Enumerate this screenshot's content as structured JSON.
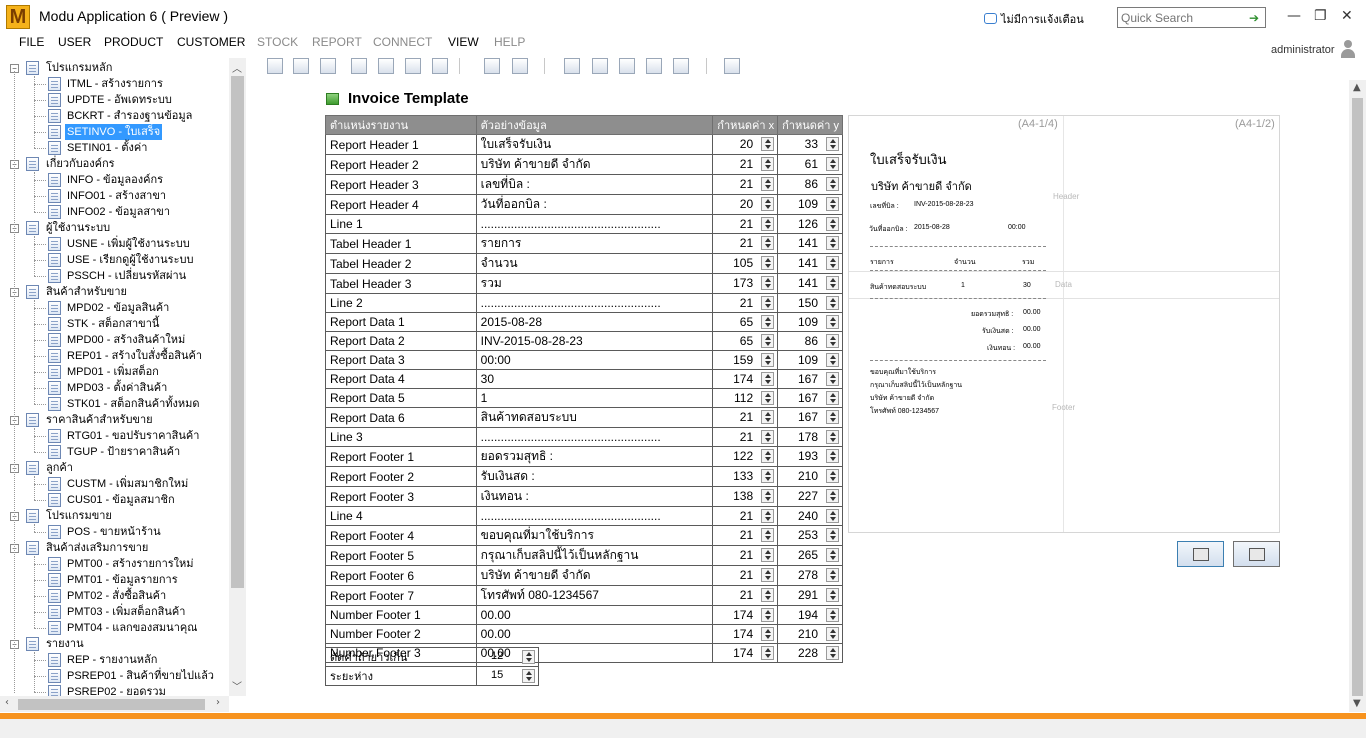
{
  "app": {
    "title": "Modu Application 6 ( Preview )",
    "logo_letter": "M"
  },
  "header": {
    "notifications": "ไม่มีการแจ้งเตือน",
    "search_placeholder": "Quick Search",
    "window_controls": [
      "—",
      "❐",
      "✕"
    ]
  },
  "menu": {
    "items": [
      {
        "label": "FILE",
        "enabled": true
      },
      {
        "label": "USER",
        "enabled": true
      },
      {
        "label": "PRODUCT",
        "enabled": true
      },
      {
        "label": "CUSTOMER",
        "enabled": true
      },
      {
        "label": "STOCK",
        "enabled": false
      },
      {
        "label": "REPORT",
        "enabled": false
      },
      {
        "label": "CONNECT",
        "enabled": false
      },
      {
        "label": "VIEW",
        "enabled": true
      },
      {
        "label": "HELP",
        "enabled": false
      }
    ],
    "user": "administrator"
  },
  "sidebar": {
    "groups": [
      {
        "label": "โปรแกรมหลัก",
        "items": [
          "ITML - สร้างรายการ",
          "UPDTE - อัพเดทระบบ",
          "BCKRT - สำรองฐานข้อมูล",
          "SETINVO - ใบเสร็จ",
          "SETIN01 - ตั้งค่า"
        ]
      },
      {
        "label": "เกี่ยวกับองค์กร",
        "items": [
          "INFO - ข้อมูลองค์กร",
          "INFO01 - สร้างสาขา",
          "INFO02 - ข้อมูลสาขา"
        ]
      },
      {
        "label": "ผู้ใช้งานระบบ",
        "items": [
          "USNE - เพิ่มผู้ใช้งานระบบ",
          "USE - เรียกดูผู้ใช้งานระบบ",
          "PSSCH - เปลี่ยนรหัสผ่าน"
        ]
      },
      {
        "label": "สินค้าสำหรับขาย",
        "items": [
          "MPD02 - ข้อมูลสินค้า",
          "STK - สต็อกสาขานี้",
          "MPD00 - สร้างสินค้าใหม่",
          "REP01 - สร้างใบสั่งซื้อสินค้า",
          "MPD01 - เพิ่มสต็อก",
          "MPD03 - ตั้งค่าสินค้า",
          "STK01 - สต็อกสินค้าทั้งหมด"
        ]
      },
      {
        "label": "ราคาสินค้าสำหรับขาย",
        "items": [
          "RTG01 - ขอปรับราคาสินค้า",
          "TGUP - ป้ายราคาสินค้า"
        ]
      },
      {
        "label": "ลูกค้า",
        "items": [
          "CUSTM - เพิ่มสมาชิกใหม่",
          "CUS01 - ข้อมูลสมาชิก"
        ]
      },
      {
        "label": "โปรแกรมขาย",
        "items": [
          "POS - ขายหน้าร้าน"
        ]
      },
      {
        "label": "สินค้าส่งเสริมการขาย",
        "items": [
          "PMT00 - สร้างรายการใหม่",
          "PMT01 - ข้อมูลรายการ",
          "PMT02 - สั่งซื้อสินค้า",
          "PMT03 - เพิ่มสต็อกสินค้า",
          "PMT04 - แลกของสมนาคุณ"
        ]
      },
      {
        "label": "รายงาน",
        "items": [
          "REP - รายงานหลัก",
          "PSREP01 - สินค้าที่ขายไปแล้ว",
          "PSREP02 - ยอดรวม"
        ]
      }
    ],
    "selected": "SETINVO - ใบเสร็จ"
  },
  "page": {
    "title": "Invoice Template"
  },
  "grid": {
    "headers": [
      "ตำแหน่งรายงาน",
      "ตัวอย่างข้อมูล",
      "กำหนดค่า x",
      "กำหนดค่า y"
    ],
    "rows": [
      {
        "name": "Report Header 1",
        "sample": "ใบเสร็จรับเงิน",
        "x": "20",
        "y": "33"
      },
      {
        "name": "Report Header 2",
        "sample": "บริษัท ค้าขายดี จำกัด",
        "x": "21",
        "y": "61"
      },
      {
        "name": "Report Header 3",
        "sample": "เลขที่บิล :",
        "x": "21",
        "y": "86"
      },
      {
        "name": "Report Header 4",
        "sample": "วันที่ออกบิล :",
        "x": "20",
        "y": "109"
      },
      {
        "name": "Line 1",
        "sample": "......................................................",
        "x": "21",
        "y": "126"
      },
      {
        "name": "Tabel Header 1",
        "sample": "รายการ",
        "x": "21",
        "y": "141"
      },
      {
        "name": "Tabel Header 2",
        "sample": "จำนวน",
        "x": "105",
        "y": "141"
      },
      {
        "name": "Tabel Header 3",
        "sample": "รวม",
        "x": "173",
        "y": "141"
      },
      {
        "name": "Line 2",
        "sample": "......................................................",
        "x": "21",
        "y": "150"
      },
      {
        "name": "Report Data 1",
        "sample": "2015-08-28",
        "x": "65",
        "y": "109"
      },
      {
        "name": "Report Data 2",
        "sample": "INV-2015-08-28-23",
        "x": "65",
        "y": "86"
      },
      {
        "name": "Report Data 3",
        "sample": "00:00",
        "x": "159",
        "y": "109"
      },
      {
        "name": "Report Data 4",
        "sample": "30",
        "x": "174",
        "y": "167"
      },
      {
        "name": "Report Data 5",
        "sample": "1",
        "x": "112",
        "y": "167"
      },
      {
        "name": "Report Data 6",
        "sample": "สินค้าทดสอบระบบ",
        "x": "21",
        "y": "167"
      },
      {
        "name": "Line 3",
        "sample": "......................................................",
        "x": "21",
        "y": "178"
      },
      {
        "name": "Report Footer 1",
        "sample": "ยอดรวมสุทธิ :",
        "x": "122",
        "y": "193"
      },
      {
        "name": "Report Footer 2",
        "sample": "รับเงินสด :",
        "x": "133",
        "y": "210"
      },
      {
        "name": "Report Footer 3",
        "sample": "เงินทอน :",
        "x": "138",
        "y": "227"
      },
      {
        "name": "Line 4",
        "sample": "......................................................",
        "x": "21",
        "y": "240"
      },
      {
        "name": "Report Footer 4",
        "sample": "ขอบคุณที่มาใช้บริการ",
        "x": "21",
        "y": "253"
      },
      {
        "name": "Report Footer 5",
        "sample": "กรุณาเก็บสลิปนี้ไว้เป็นหลักฐาน",
        "x": "21",
        "y": "265"
      },
      {
        "name": "Report Footer 6",
        "sample": "บริษัท ค้าขายดี จำกัด",
        "x": "21",
        "y": "278"
      },
      {
        "name": "Report Footer 7",
        "sample": "โทรศัพท์ 080-1234567",
        "x": "21",
        "y": "291"
      },
      {
        "name": "Number Footer 1",
        "sample": "00.00",
        "x": "174",
        "y": "194"
      },
      {
        "name": "Number Footer 2",
        "sample": "00.00",
        "x": "174",
        "y": "210"
      },
      {
        "name": "Number Footer 3",
        "sample": "00.00",
        "x": "174",
        "y": "228"
      }
    ]
  },
  "extra": [
    {
      "label": "ตัดคำถ้ายาวเกิน",
      "value": "12"
    },
    {
      "label": "ระยะห่าง",
      "value": "15"
    }
  ],
  "preview": {
    "page_left": "(A4-1/4)",
    "page_right": "(A4-1/2)",
    "band_header": "Header",
    "band_data": "Data",
    "band_footer": "Footer",
    "title": "ใบเสร็จรับเงิน",
    "company": "บริษัท ค้าขายดี จำกัด",
    "bill_label": "เลขที่บิล :",
    "bill_value": "INV-2015-08-28-23",
    "date_label": "วันที่ออกบิล :",
    "date_value": "2015-08-28",
    "time_value": "00:00",
    "col1": "รายการ",
    "col2": "จำนวน",
    "col3": "รวม",
    "item_name": "สินค้าทดสอบระบบ",
    "item_qty": "1",
    "item_total": "30",
    "f1_label": "ยอดรวมสุทธิ :",
    "f1_value": "00.00",
    "f2_label": "รับเงินสด :",
    "f2_value": "00.00",
    "f3_label": "เงินทอน :",
    "f3_value": "00.00",
    "f4": "ขอบคุณที่มาใช้บริการ",
    "f5": "กรุณาเก็บสลิปนี้ไว้เป็นหลักฐาน",
    "f6": "บริษัท ค้าขายดี จำกัด",
    "f7": "โทรศัพท์ 080-1234567"
  },
  "buttons": {
    "print_icon": "printer-icon",
    "export_icon": "export-icon"
  },
  "colors": {
    "accent_bar": "#f7931e",
    "selection": "#3399ff",
    "grid_header": "#8e8e8e"
  }
}
